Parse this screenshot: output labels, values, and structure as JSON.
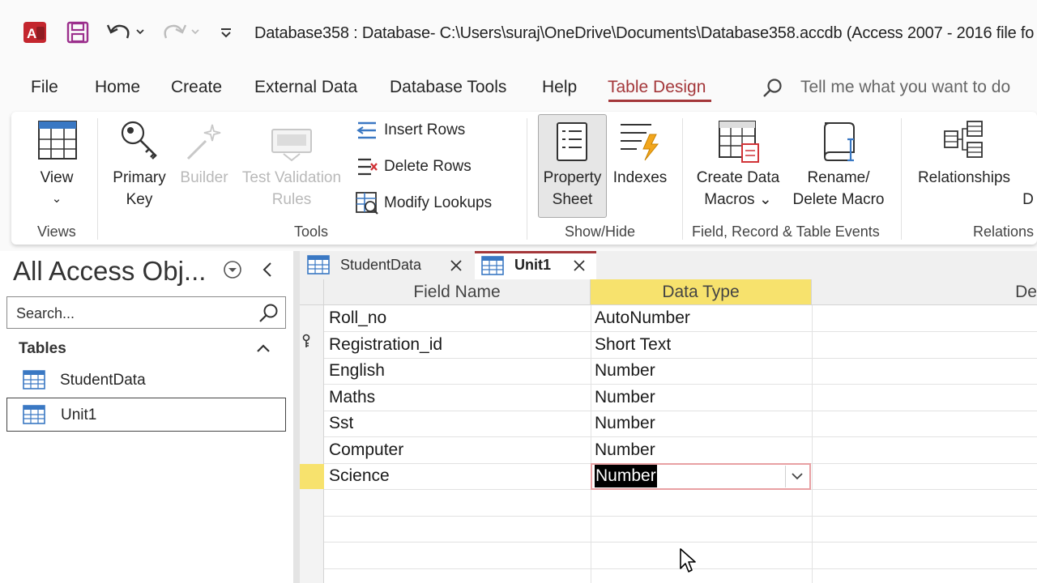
{
  "window": {
    "title": "Database358 : Database- C:\\Users\\suraj\\OneDrive\\Documents\\Database358.accdb (Access 2007 - 2016 file fo"
  },
  "menu": {
    "items": [
      "File",
      "Home",
      "Create",
      "External Data",
      "Database Tools",
      "Help",
      "Table Design"
    ],
    "active": "Table Design",
    "tell_me": "Tell me what you want to do"
  },
  "ribbon": {
    "view": {
      "label": "View",
      "arrow": "⌄"
    },
    "primary_key": {
      "line1": "Primary",
      "line2": "Key"
    },
    "builder": {
      "label": "Builder"
    },
    "test_validation": {
      "line1": "Test Validation",
      "line2": "Rules"
    },
    "insert_rows": "Insert Rows",
    "delete_rows": "Delete Rows",
    "modify_lookups": "Modify Lookups",
    "property_sheet": {
      "line1": "Property",
      "line2": "Sheet"
    },
    "indexes": "Indexes",
    "create_data_macros": {
      "line1": "Create Data",
      "line2": "Macros ⌄"
    },
    "rename_delete_macro": {
      "line1": "Rename/",
      "line2": "Delete Macro"
    },
    "relationships": "Relationships",
    "cut_off": "D",
    "groups": {
      "views": "Views",
      "tools": "Tools",
      "show_hide": "Show/Hide",
      "field_record_table_events": "Field, Record & Table Events",
      "relationships": "Relations"
    }
  },
  "nav_pane": {
    "title": "All Access Obj...",
    "search_placeholder": "Search...",
    "section": "Tables",
    "items": [
      "StudentData",
      "Unit1"
    ],
    "selected": "Unit1"
  },
  "doc_tabs": [
    {
      "label": "StudentData",
      "active": false
    },
    {
      "label": "Unit1",
      "active": true
    }
  ],
  "design_grid": {
    "columns": [
      "Field Name",
      "Data Type",
      "De"
    ],
    "rows": [
      {
        "field": "Roll_no",
        "type": "AutoNumber",
        "primary_key": false
      },
      {
        "field": "Registration_id",
        "type": "Short Text",
        "primary_key": true
      },
      {
        "field": "English",
        "type": "Number",
        "primary_key": false
      },
      {
        "field": "Maths",
        "type": "Number",
        "primary_key": false
      },
      {
        "field": "Sst",
        "type": "Number",
        "primary_key": false
      },
      {
        "field": "Computer",
        "type": "Number",
        "primary_key": false
      },
      {
        "field": "Science",
        "type": "Number",
        "primary_key": false
      }
    ],
    "editing": {
      "row": 6,
      "value": "Number"
    }
  },
  "colors": {
    "accent": "#a4373a",
    "access_brand": "#a4373a",
    "selected_column": "#f7e26d"
  }
}
